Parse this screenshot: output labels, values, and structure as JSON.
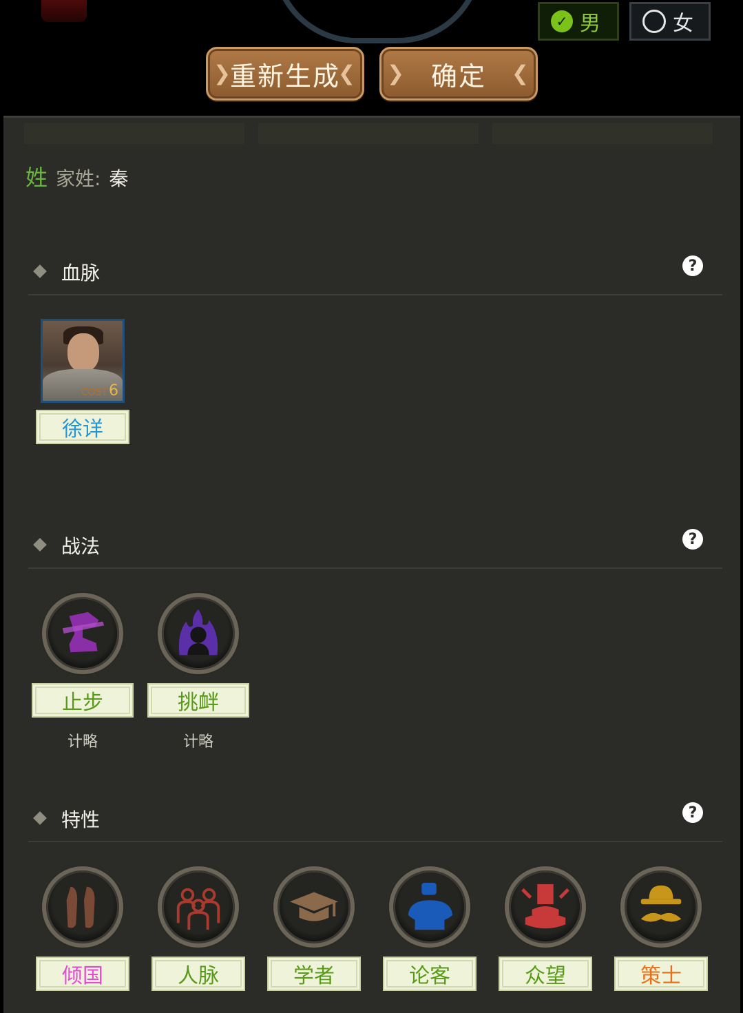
{
  "gender": {
    "male": "男",
    "female": "女",
    "selected": "男"
  },
  "buttons": {
    "regenerate": "重新生成",
    "confirm": "确定"
  },
  "surname": {
    "mark": "姓",
    "label": "家姓:",
    "value": "秦"
  },
  "sections": {
    "bloodline": {
      "title": "血脉"
    },
    "tactics": {
      "title": "战法"
    },
    "traits": {
      "title": "特性"
    }
  },
  "bloodline": {
    "name": "徐详",
    "cost_label": "COST",
    "cost": "6"
  },
  "tactics": [
    {
      "name": "止步",
      "type": "计略",
      "icon": "boot-icon",
      "color": "#8b2fa8"
    },
    {
      "name": "挑衅",
      "type": "计略",
      "icon": "flame-figure-icon",
      "color": "#5b2fa8"
    }
  ],
  "traits": [
    {
      "name": "倾国",
      "icon": "ballet-shoes-icon",
      "color": "#7a4a36",
      "label_color": "#e54ad7"
    },
    {
      "name": "人脉",
      "icon": "people-icon",
      "color": "#a83a2e",
      "label_color": "#5a9a1a"
    },
    {
      "name": "学者",
      "icon": "graduation-cap-icon",
      "color": "#8a6a4a",
      "label_color": "#5a9a1a"
    },
    {
      "name": "论客",
      "icon": "speaker-icon",
      "color": "#1a5ab8",
      "label_color": "#5a9a1a"
    },
    {
      "name": "众望",
      "icon": "podium-icon",
      "color": "#c83a3a",
      "label_color": "#5a9a1a"
    },
    {
      "name": "策士",
      "icon": "hat-mustache-icon",
      "color": "#c8961a",
      "label_color": "#e8701a"
    }
  ]
}
